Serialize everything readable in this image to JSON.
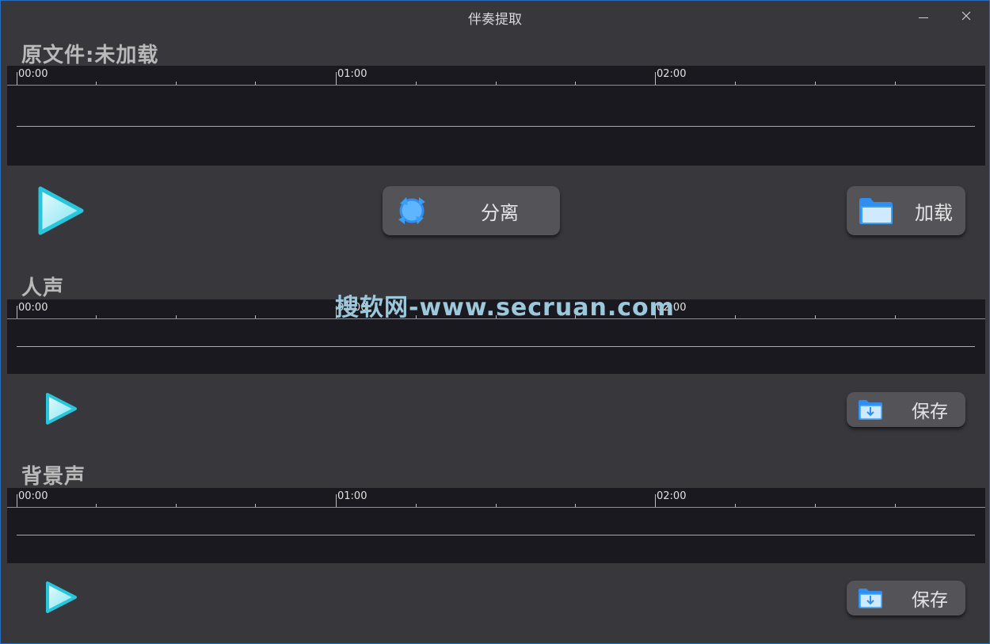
{
  "window": {
    "title": "伴奏提取"
  },
  "sections": {
    "original": {
      "label": "原文件:未加载"
    },
    "vocals": {
      "label": "人声"
    },
    "background": {
      "label": "背景声"
    }
  },
  "ruler": {
    "labels": [
      "00:00",
      "01:00",
      "02:00"
    ]
  },
  "buttons": {
    "separate_label": "分离",
    "load_label": "加载",
    "save_vocals_label": "保存",
    "save_background_label": "保存"
  },
  "watermark": {
    "text": "搜软网-www.secruan.com"
  },
  "colors": {
    "background": "#38373c",
    "waveform": "#1b1920",
    "play_accent": "#27c6dc",
    "icon_blue": "#3aa0f5"
  }
}
